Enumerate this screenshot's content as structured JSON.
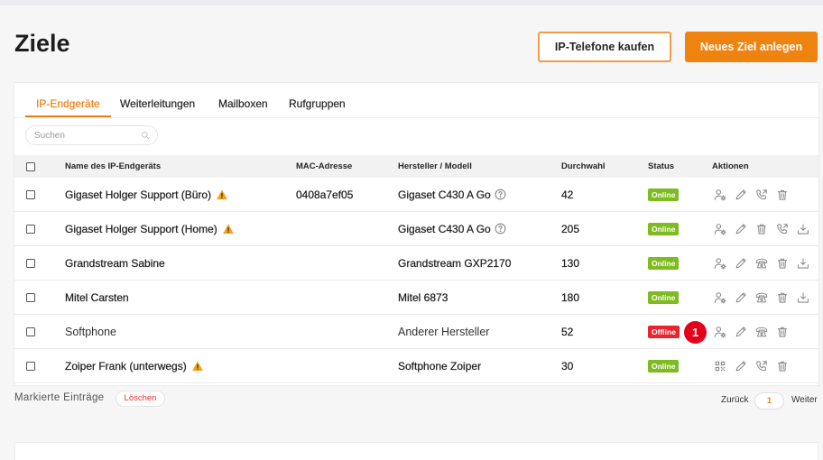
{
  "page": {
    "title": "Ziele"
  },
  "header_actions": {
    "buy_phones_label": "IP-Telefone kaufen",
    "new_target_label": "Neues Ziel anlegen"
  },
  "tabs": [
    {
      "label": "IP-Endgeräte",
      "active": true
    },
    {
      "label": "Weiterleitungen",
      "active": false
    },
    {
      "label": "Mailboxen",
      "active": false
    },
    {
      "label": "Rufgruppen",
      "active": false
    }
  ],
  "search": {
    "placeholder": "Suchen",
    "icon": "search-icon"
  },
  "table": {
    "columns": {
      "name": "Name des IP-Endgeräts",
      "mac": "MAC-Adresse",
      "model": "Hersteller / Modell",
      "extension": "Durchwahl",
      "status": "Status",
      "actions": "Aktionen"
    },
    "rows": [
      {
        "name": "Gigaset Holger Support (Büro)",
        "warning": true,
        "mac": "0408a7ef05",
        "model": "Gigaset C430 A Go",
        "model_help": true,
        "extension": "42",
        "status": "Online",
        "actions": [
          "user-settings-icon",
          "pencil-icon",
          "call-forward-icon",
          "trash-icon"
        ]
      },
      {
        "name": "Gigaset Holger Support (Home)",
        "warning": true,
        "mac": "",
        "model": "Gigaset C430 A Go",
        "model_help": true,
        "extension": "205",
        "status": "Online",
        "actions": [
          "user-settings-icon",
          "pencil-icon",
          "trash-icon",
          "call-forward-icon",
          "download-tray-icon"
        ]
      },
      {
        "name": "Grandstream Sabine",
        "warning": false,
        "mac": "",
        "model": "Grandstream GXP2170",
        "model_help": false,
        "extension": "130",
        "status": "Online",
        "actions": [
          "user-settings-icon",
          "pencil-icon",
          "desk-phone-icon",
          "trash-icon",
          "download-tray-icon"
        ]
      },
      {
        "name": "Mitel Carsten",
        "warning": false,
        "mac": "",
        "model": "Mitel 6873",
        "model_help": false,
        "extension": "180",
        "status": "Online",
        "actions": [
          "user-settings-icon",
          "pencil-icon",
          "desk-phone-icon",
          "trash-icon",
          "download-tray-icon"
        ]
      },
      {
        "name": "Softphone",
        "warning": false,
        "mac": "",
        "model": "Anderer Hersteller",
        "model_help": false,
        "extension": "52",
        "status": "Offline",
        "actions": [
          "user-settings-icon",
          "pencil-icon",
          "desk-phone-icon",
          "trash-icon"
        ]
      },
      {
        "name": "Zoiper Frank (unterwegs)",
        "warning": true,
        "mac": "",
        "model": "Softphone Zoiper",
        "model_help": false,
        "extension": "30",
        "status": "Online",
        "actions": [
          "qr-code-icon",
          "pencil-icon",
          "call-forward-icon",
          "trash-icon"
        ]
      }
    ]
  },
  "callout": {
    "number": "1"
  },
  "footer": {
    "marked_label": "Markierte Einträge",
    "delete_label": "Löschen"
  },
  "pagination": {
    "prev_label": "Zurück",
    "current_page": "1",
    "next_label": "Weiter"
  },
  "colors": {
    "accent": "#ee7f12",
    "online": "#7dbb21",
    "offline": "#e8242c",
    "callout": "#e2001a"
  }
}
